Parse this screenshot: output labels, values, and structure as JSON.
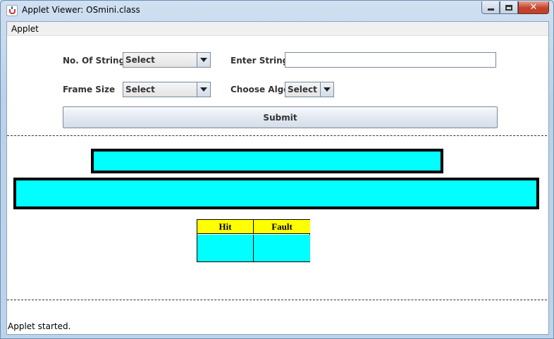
{
  "window": {
    "title": "Applet Viewer: OSmini.class",
    "icon": "java-icon",
    "controls": [
      "minimize-icon",
      "maximize-icon",
      "close-icon"
    ]
  },
  "menubar": {
    "items": [
      {
        "label": "Applet"
      }
    ]
  },
  "form": {
    "no_of_string_label": "No. Of String",
    "no_of_string_value": "Select",
    "enter_string_label": "Enter String",
    "enter_string_value": "",
    "frame_size_label": "Frame Size",
    "frame_size_value": "Select",
    "choose_algo_label": "Choose Algo",
    "choose_algo_value": "Select",
    "submit_label": "Submit"
  },
  "results": {
    "headers": [
      "Hit",
      "Fault"
    ],
    "values": [
      "",
      ""
    ]
  },
  "status": {
    "text": "Applet started."
  },
  "colors": {
    "panel_fill": "#00ffff",
    "header_fill": "#ffff00",
    "border": "#000000"
  }
}
